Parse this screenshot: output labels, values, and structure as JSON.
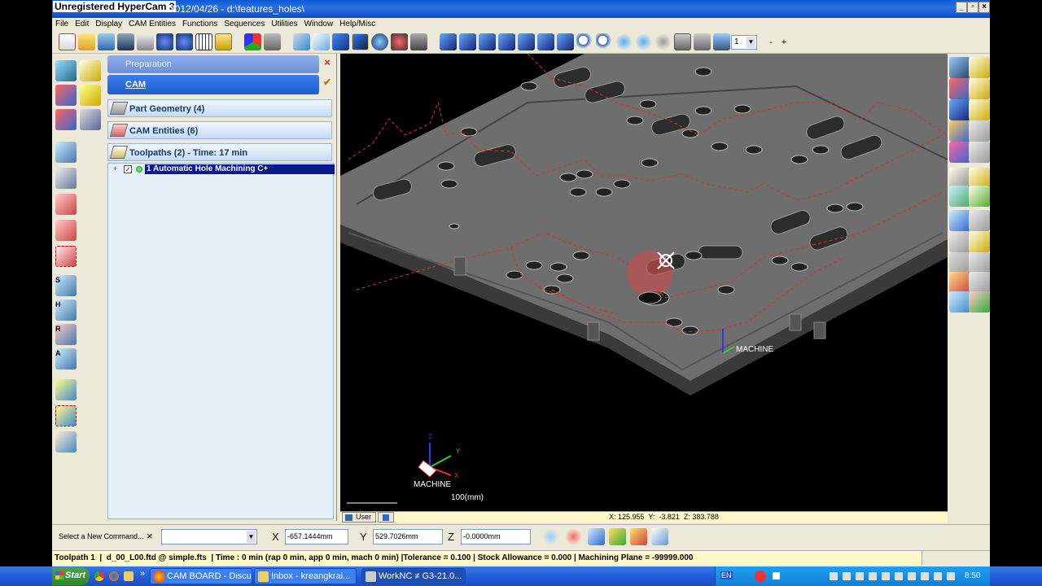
{
  "window": {
    "app_title": "Unregistered HyperCam 3",
    "title_rest": "2012/04/26 - d:\\features_holes\\"
  },
  "menu": [
    "File",
    "Edit",
    "Display",
    "CAM Entities",
    "Functions",
    "Sequences",
    "Utilities",
    "Window",
    "Help/Misc"
  ],
  "toolbar": {
    "layer_value": "1",
    "minus": "-",
    "plus": "+"
  },
  "panel": {
    "preparation": "Preparation",
    "cam": "CAM",
    "part_geometry": "Part Geometry (4)",
    "cam_entities": "CAM Entities (6)",
    "toolpaths": "Toolpaths (2) - Time: 17 min",
    "tree_item": "1 Automatic Hole Machining  C+"
  },
  "left_tools": {
    "s": "S",
    "h": "H",
    "r": "R",
    "a": "A"
  },
  "viewport": {
    "machine_label": "MACHINE",
    "triad_label": "MACHINE",
    "scale": "100(mm)",
    "axes": {
      "x": "X",
      "y": "Y",
      "z": "Z"
    }
  },
  "viewstatus": {
    "tab": "User",
    "coords": "X: 125.955  Y:  -3.821  Z: 383.788"
  },
  "cmd": {
    "label": "Select a New Command...",
    "close": "×",
    "x_label": "X",
    "x_val": "-657.1444mm",
    "y_label": "Y",
    "y_val": "529.7026mm",
    "z_label": "Z",
    "z_val": "-0.0000mm"
  },
  "status": "Toolpath 1  |  d_00_L00.ftd @ simple.fts  | Time : 0 min (rap 0 min, app 0 min, mach 0 min) |Tolerance = 0.100 | Stock Allowance = 0.000 | Machining Plane = -99999.000",
  "taskbar": {
    "start": "Start",
    "tasks": [
      "CAM BOARD - Discu...",
      "Inbox - kreangkrai...",
      "WorkNC ≠ G3-21.0..."
    ],
    "lang": "EN",
    "time": "8:50"
  },
  "colors": {
    "toolpath": "#e0302a",
    "plate": "#6e6e6e",
    "accent": "#1c5dd2",
    "status_bg": "#fff9c9"
  }
}
